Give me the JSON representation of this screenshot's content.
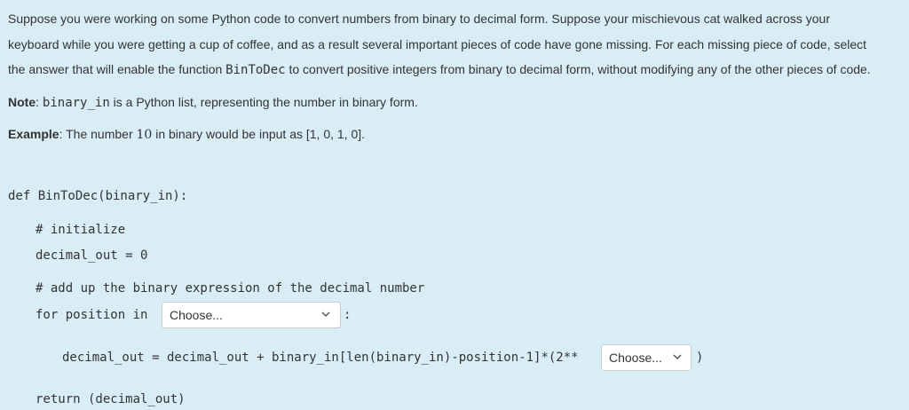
{
  "question": {
    "line1": "Suppose you were working on some Python code to convert numbers from binary to decimal form. Suppose your mischievous cat walked across your",
    "line2": "keyboard while you were getting a cup of coffee, and as a result several important pieces of code have gone missing. For each missing piece of code, select",
    "line3_a": "the answer that will enable the function ",
    "line3_fn": "BinToDec",
    "line3_b": " to convert positive integers from binary to decimal form, without modifying any of the other pieces of code.",
    "note_label": "Note",
    "note_sep": ": ",
    "note_var": "binary_in",
    "note_text": " is a Python list, representing the number in binary form.",
    "example_label": "Example",
    "example_a": ": The number ",
    "example_num": "10",
    "example_b": " in binary would be input as [1, 0, 1, 0]."
  },
  "code": {
    "def_line": "def BinToDec(binary_in):",
    "comment_init": "# initialize",
    "init_line": "decimal_out = 0",
    "comment_add": "# add up the binary expression of the decimal number",
    "for_prefix": "for position in",
    "for_colon": ":",
    "assign_line": "decimal_out = decimal_out + binary_in[len(binary_in)-position-1]*(2**",
    "close_paren": ")",
    "return_line": "return (decimal_out)"
  },
  "dropdowns": {
    "range_select": {
      "value": "Choose...",
      "icon": "chevron-down-icon"
    },
    "power_select": {
      "value": "Choose...",
      "icon": "chevron-down-icon"
    }
  }
}
